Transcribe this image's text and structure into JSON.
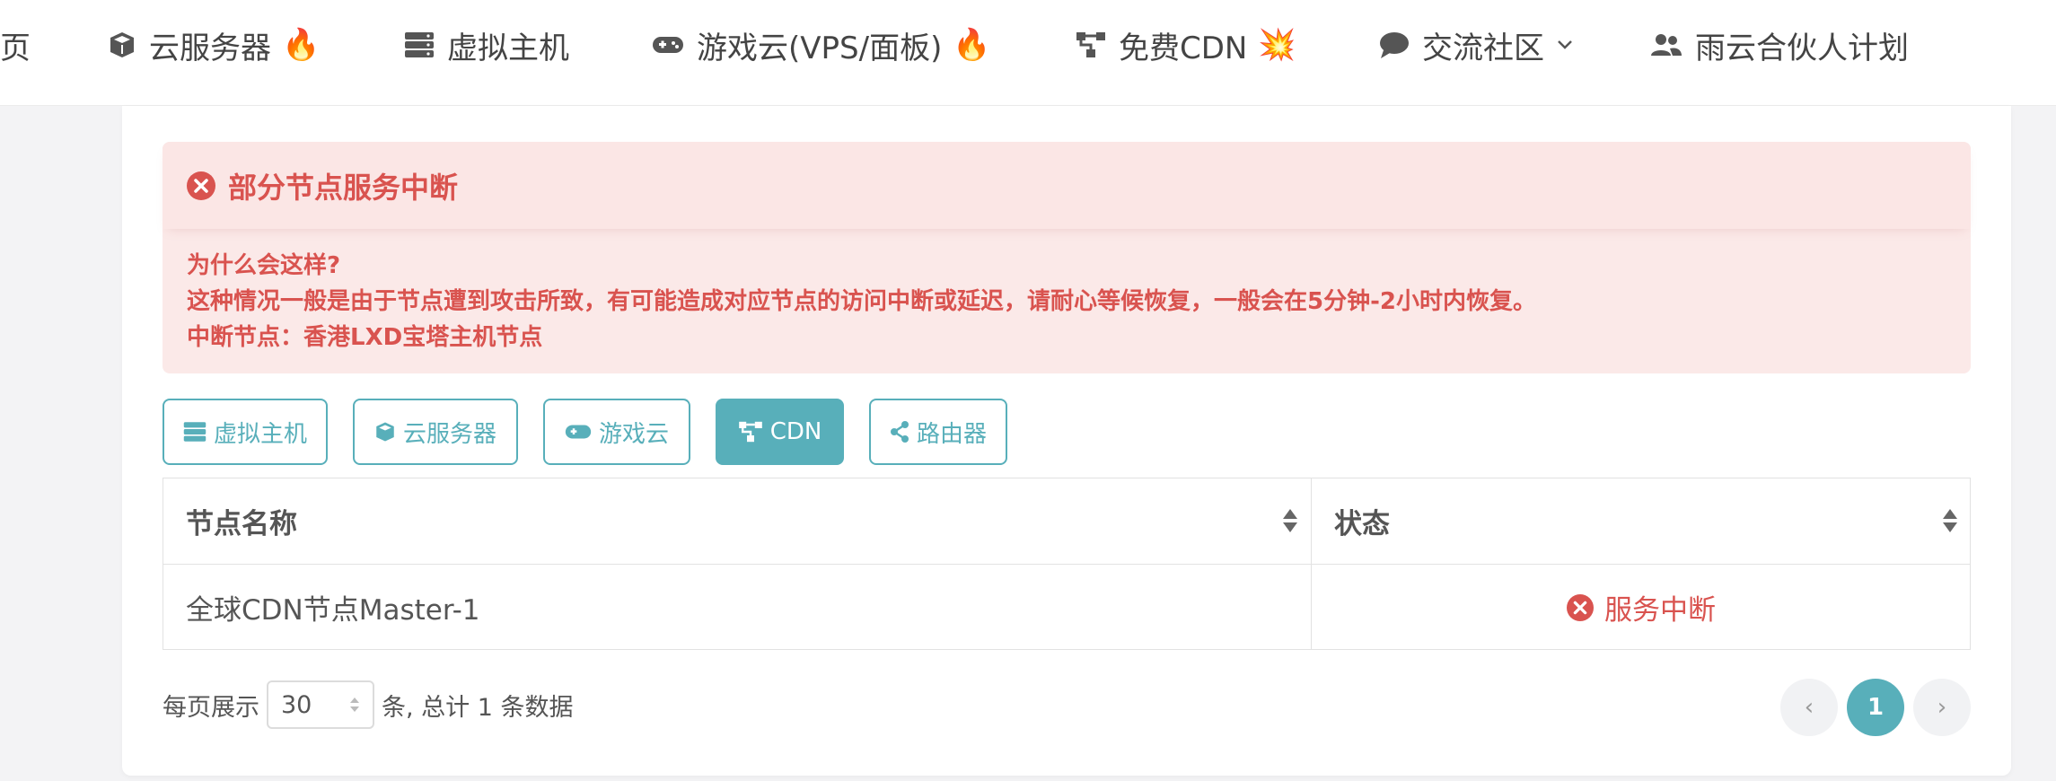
{
  "nav": {
    "items": [
      {
        "label": "页",
        "icon": "none"
      },
      {
        "label": "云服务器",
        "icon": "cube-icon",
        "badge": "🔥"
      },
      {
        "label": "虚拟主机",
        "icon": "server-icon"
      },
      {
        "label": "游戏云(VPS/面板)",
        "icon": "gamepad-icon",
        "badge": "🔥"
      },
      {
        "label": "免费CDN",
        "icon": "sitemap-icon",
        "badge": "💥"
      },
      {
        "label": "交流社区",
        "icon": "comment-icon"
      },
      {
        "label": "雨云合伙人计划",
        "icon": "users-icon"
      }
    ]
  },
  "alert": {
    "title": "部分节点服务中断",
    "lines": [
      "为什么会这样?",
      "这种情况一般是由于节点遭到攻击所致，有可能造成对应节点的访问中断或延迟，请耐心等候恢复，一般会在5分钟-2小时内恢复。",
      "中断节点：香港LXD宝塔主机节点"
    ]
  },
  "tabs": [
    {
      "label": "虚拟主机",
      "icon": "server-icon",
      "active": false
    },
    {
      "label": "云服务器",
      "icon": "cube-icon",
      "active": false
    },
    {
      "label": "游戏云",
      "icon": "gamepad-icon",
      "active": false
    },
    {
      "label": "CDN",
      "icon": "sitemap-icon",
      "active": true
    },
    {
      "label": "路由器",
      "icon": "share-icon",
      "active": false
    }
  ],
  "table": {
    "headers": [
      "节点名称",
      "状态"
    ],
    "rows": [
      {
        "name": "全球CDN节点Master-1",
        "status": "服务中断"
      }
    ]
  },
  "pager": {
    "prefix": "每页展示",
    "page_size": "30",
    "suffix": "条, 总计 1 条数据",
    "current_page": "1",
    "prev": "‹",
    "next": "›"
  },
  "colors": {
    "accent": "#58afba",
    "danger": "#d9534f",
    "alert_bg": "#fbe9e8"
  }
}
